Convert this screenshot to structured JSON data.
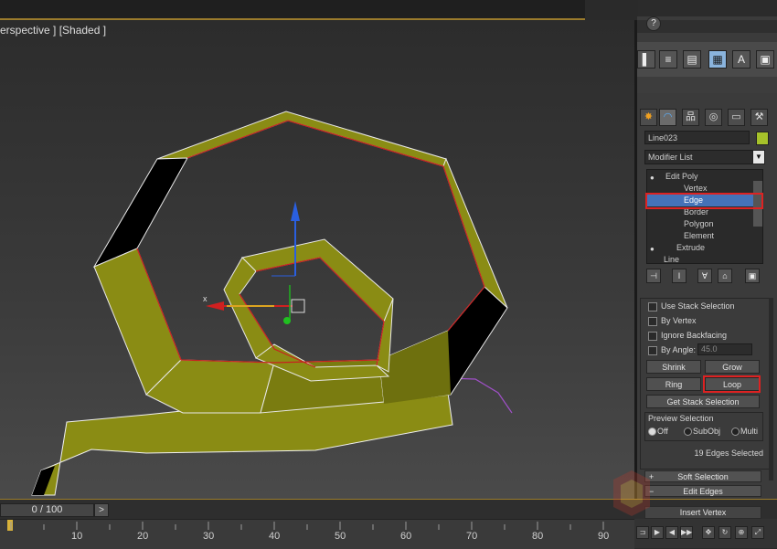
{
  "viewport": {
    "label": "erspective ] [Shaded ]",
    "axis_x": "x"
  },
  "command_panel": {
    "tabs": [
      "create-icon",
      "modify-icon",
      "hierarchy-icon",
      "motion-icon",
      "display-icon",
      "utilities-icon"
    ],
    "object_name": "Line023",
    "modifier_list": "Modifier List",
    "stack": {
      "items": [
        {
          "label": "Edit Poly",
          "level": 0
        },
        {
          "label": "Vertex",
          "level": 1
        },
        {
          "label": "Edge",
          "level": 1,
          "selected": true
        },
        {
          "label": "Border",
          "level": 1
        },
        {
          "label": "Polygon",
          "level": 1
        },
        {
          "label": "Element",
          "level": 1
        },
        {
          "label": "Extrude",
          "level": 0
        },
        {
          "label": "Line",
          "level": 0
        }
      ]
    },
    "selection": {
      "use_stack_selection": "Use Stack Selection",
      "by_vertex": "By Vertex",
      "ignore_backfacing": "Ignore Backfacing",
      "by_angle": "By Angle:",
      "angle_value": "45.0",
      "shrink": "Shrink",
      "grow": "Grow",
      "ring": "Ring",
      "loop": "Loop",
      "get_stack_selection": "Get Stack Selection",
      "preview_selection": "Preview Selection",
      "preview_off": "Off",
      "preview_subobj": "SubObj",
      "preview_multi": "Multi",
      "status": "19 Edges Selected"
    },
    "rollouts": [
      "Soft Selection",
      "Edit Edges",
      "Insert Vertex"
    ]
  },
  "timeline": {
    "slider_label": "0 / 100",
    "next_label": ">",
    "ticks": [
      "10",
      "20",
      "30",
      "40",
      "50",
      "60",
      "70",
      "80",
      "90"
    ]
  },
  "colors": {
    "accent": "#9a7b2c",
    "selection": "#4472b8",
    "highlight_box": "#d22222",
    "mesh": "#8a8c14"
  }
}
